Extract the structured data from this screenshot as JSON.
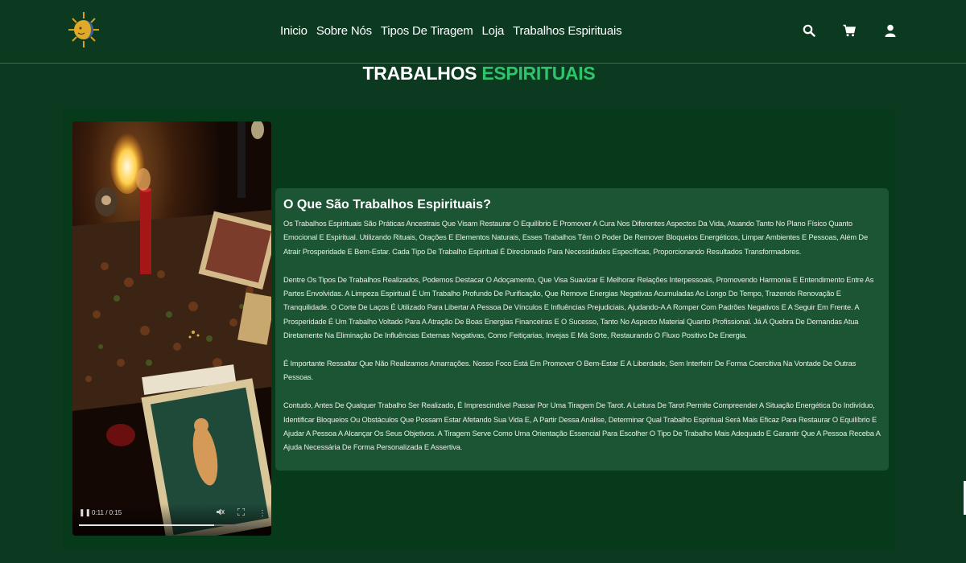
{
  "nav": {
    "items": [
      {
        "label": "Inicio"
      },
      {
        "label": "Sobre Nós"
      },
      {
        "label": "Tipos De Tiragem"
      },
      {
        "label": "Loja"
      },
      {
        "label": "Trabalhos Espirituais"
      }
    ]
  },
  "icons": {
    "search": "search-icon",
    "cart": "cart-icon",
    "user": "user-icon",
    "logo": "sun-moon-logo"
  },
  "page": {
    "title_part1": "TRABALHOS",
    "title_part2": "ESPIRITUAIS"
  },
  "video": {
    "time": "0:11 / 0:15",
    "progress": 0.73
  },
  "section": {
    "heading": "O Que São Trabalhos Espirituais?",
    "paragraphs": [
      "Os Trabalhos Espirituais São Práticas Ancestrais Que Visam Restaurar O Equilíbrio E Promover A Cura Nos Diferentes Aspectos Da Vida, Atuando Tanto No Plano Físico Quanto Emocional E Espiritual. Utilizando Rituais, Orações E Elementos Naturais, Esses Trabalhos Têm O Poder De Remover Bloqueios Energéticos, Limpar Ambientes E Pessoas, Além De Atrair Prosperidade E Bem-Estar. Cada Tipo De Trabalho Espiritual É Direcionado Para Necessidades Específicas, Proporcionando Resultados Transformadores.",
      "Dentre Os Tipos De Trabalhos Realizados, Podemos Destacar O Adoçamento, Que Visa Suavizar E Melhorar Relações Interpessoais, Promovendo Harmonia E Entendimento Entre As Partes Envolvidas. A Limpeza Espiritual É Um Trabalho Profundo De Purificação, Que Remove Energias Negativas Acumuladas Ao Longo Do Tempo, Trazendo Renovação E Tranquilidade. O Corte De Laços É Utilizado Para Libertar A Pessoa De Vínculos E Influências Prejudiciais, Ajudando-A A Romper Com Padrões Negativos E A Seguir Em Frente. A Prosperidade É Um Trabalho Voltado Para A Atração De Boas Energias Financeiras E O Sucesso, Tanto No Aspecto Material Quanto Profissional. Já A Quebra De Demandas Atua Diretamente Na Eliminação De Influências Externas Negativas, Como Feitiçarias, Invejas E Má Sorte, Restaurando O Fluxo Positivo De Energia.",
      " É Importante Ressaltar Que Não Realizamos Amarrações. Nosso Foco Está Em Promover O Bem-Estar E A Liberdade, Sem Interferir De Forma Coercitiva Na Vontade De Outras Pessoas.",
      "Contudo, Antes De Qualquer Trabalho Ser Realizado, É Imprescindível Passar Por Uma Tiragem De Tarot. A Leitura De Tarot Permite Compreender A Situação Energética Do Indivíduo, Identificar Bloqueios Ou Obstáculos Que Possam Estar Afetando Sua Vida E, A Partir Dessa Análise, Determinar Qual Trabalho Espiritual Será Mais Eficaz Para Restaurar O Equilíbrio E Ajudar A Pessoa A Alcançar Os Seus Objetivos. A Tiragem Serve Como Uma Orientação Essencial Para Escolher O Tipo De Trabalho Mais Adequado E Garantir Que A Pessoa Receba A Ajuda Necessária De Forma Personalizada E Assertiva."
    ]
  },
  "colors": {
    "background": "#0c3a21",
    "card": "#063a1b",
    "textbox": "#1b5533",
    "accent": "#2fc36c"
  }
}
